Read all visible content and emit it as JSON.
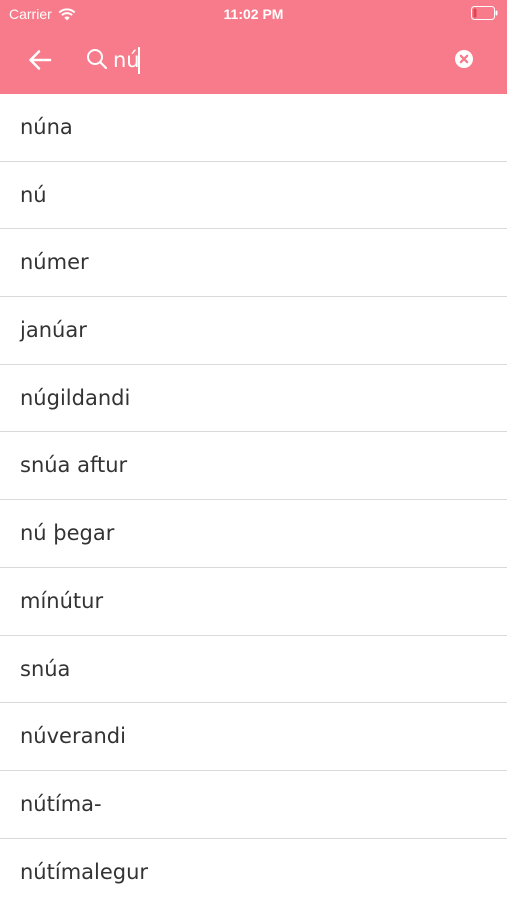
{
  "status_bar": {
    "carrier": "Carrier",
    "time": "11:02 PM",
    "icons": [
      "wifi-icon",
      "battery-icon"
    ]
  },
  "search": {
    "value": "nú",
    "back_icon": "arrow-left-icon",
    "search_icon": "search-icon",
    "clear_icon": "clear-circle-icon"
  },
  "colors": {
    "header": "#f77b8a",
    "text": "#333333",
    "divider": "#d9d9d9",
    "battery_low": "#e0464f"
  },
  "results": [
    "núna",
    "nú",
    "númer",
    "janúar",
    "núgildandi",
    "snúa aftur",
    "nú þegar",
    "mínútur",
    "snúa",
    "núverandi",
    "nútíma-",
    "nútímalegur"
  ]
}
